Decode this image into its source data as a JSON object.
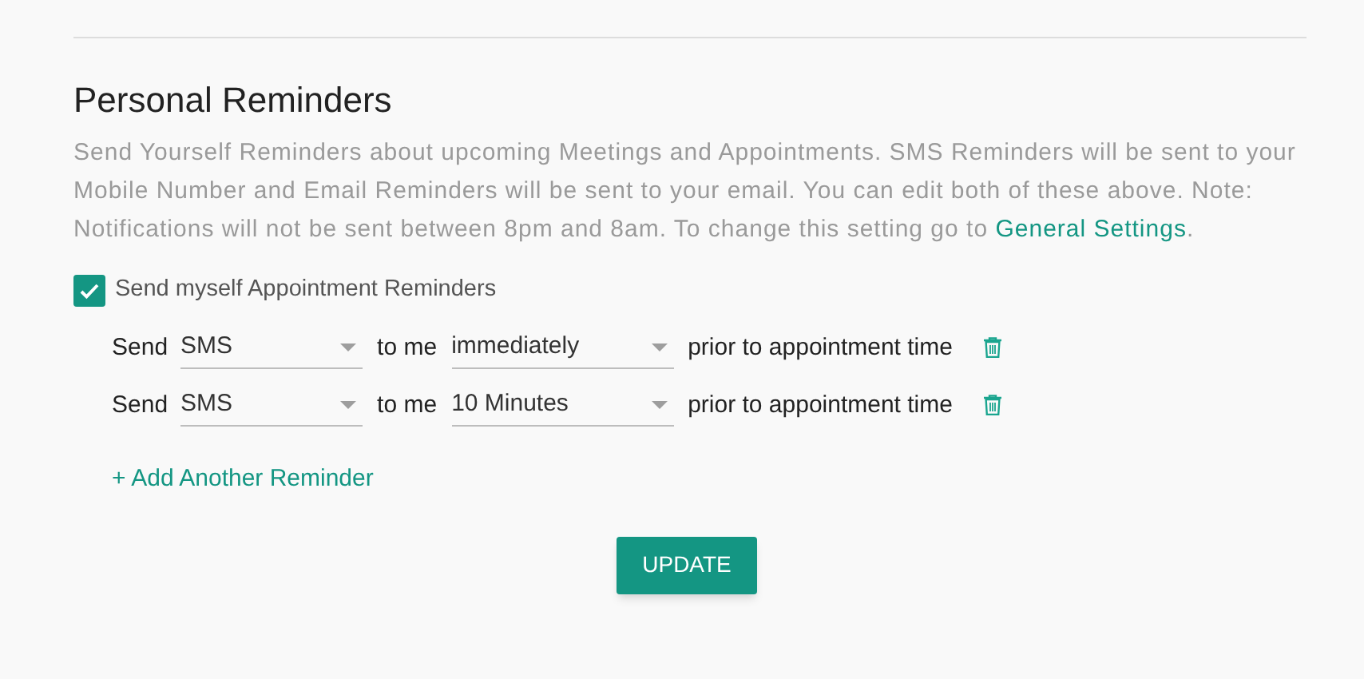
{
  "section": {
    "title": "Personal Reminders",
    "description": "Send Yourself Reminders about upcoming Meetings and Appointments. SMS Reminders will be sent to your Mobile Number and Email Reminders will be sent to your email. You can edit both of these above. Note: Notifications will not be sent between 8pm and 8am. To change this setting go to",
    "link": "General Settings",
    "after_link": "."
  },
  "enable": {
    "label": "Send myself Appointment Reminders",
    "checked": true
  },
  "reminders": [
    {
      "send_label": "Send",
      "method": "SMS",
      "to_label": "to me",
      "timing": "immediately",
      "suffix": "prior to appointment time"
    },
    {
      "send_label": "Send",
      "method": "SMS",
      "to_label": "to me",
      "timing": "10 Minutes",
      "suffix": "prior to appointment time"
    }
  ],
  "add_link": "+ Add Another Reminder",
  "update_button": "UPDATE"
}
